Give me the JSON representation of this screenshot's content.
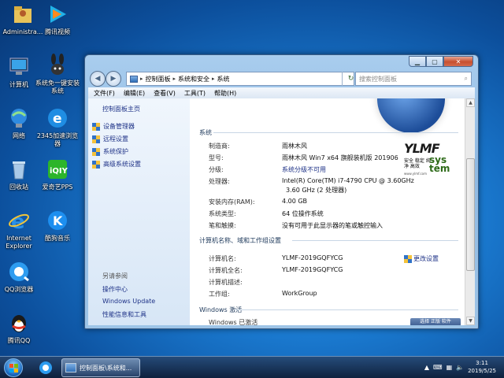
{
  "desktop": {
    "icons": [
      {
        "label": "Administra..."
      },
      {
        "label": "腾讯视频"
      },
      {
        "label": "计算机"
      },
      {
        "label": "系统免一键安装系统"
      },
      {
        "label": "网络"
      },
      {
        "label": "2345加速浏览器"
      },
      {
        "label": "回收站"
      },
      {
        "label": "爱奇艺PPS"
      },
      {
        "label": "Internet Explorer"
      },
      {
        "label": "酷狗音乐"
      },
      {
        "label": "QQ浏览器"
      },
      {
        "label": "腾讯QQ"
      }
    ]
  },
  "window": {
    "address": {
      "crumbs": [
        "控制面板",
        "系统和安全",
        "系统"
      ]
    },
    "search_placeholder": "搜索控制面板",
    "menu": [
      "文件(F)",
      "编辑(E)",
      "查看(V)",
      "工具(T)",
      "帮助(H)"
    ],
    "left": {
      "home": "控制面板主页",
      "links": [
        "设备管理器",
        "远程设置",
        "系统保护",
        "高级系统设置"
      ],
      "see_also_title": "另请参阅",
      "see_also": [
        "操作中心",
        "Windows Update",
        "性能信息和工具"
      ]
    },
    "system": {
      "header": "系统",
      "rows": [
        {
          "label": "制造商:",
          "value": "雨林木风"
        },
        {
          "label": "型号:",
          "value": "雨林木风 Win7 x64 旗舰装机版 201906"
        },
        {
          "label": "分级:",
          "value": "系统分级不可用"
        },
        {
          "label": "处理器:",
          "value": "Intel(R) Core(TM) i7-4790 CPU @ 3.60GHz",
          "value2": "3.60 GHz  (2 处理器)"
        },
        {
          "label": "安装内存(RAM):",
          "value": "4.00 GB"
        },
        {
          "label": "系统类型:",
          "value": "64 位操作系统"
        },
        {
          "label": "笔和触摸:",
          "value": "没有可用于此显示器的笔或触控输入"
        }
      ],
      "oem_logo": {
        "big": "YLMF",
        "sub": "安全 稳定 纯净 高效",
        "sys": "sys tem",
        "url": "www.ylmf.com"
      }
    },
    "computer": {
      "header": "计算机名称、域和工作组设置",
      "rows": [
        {
          "label": "计算机名:",
          "value": "YLMF-2019GQFYCG"
        },
        {
          "label": "计算机全名:",
          "value": "YLMF-2019GQFYCG"
        },
        {
          "label": "计算机描述:",
          "value": ""
        },
        {
          "label": "工作组:",
          "value": "WorkGroup"
        }
      ],
      "change": "更改设置"
    },
    "activation": {
      "header": "Windows 激活",
      "status": "Windows 已激活",
      "badge": "选择 正版 软件"
    }
  },
  "taskbar": {
    "task_label": "控制面板\\系统和...",
    "clock_time": "3:11",
    "clock_date": "2019/5/25"
  }
}
